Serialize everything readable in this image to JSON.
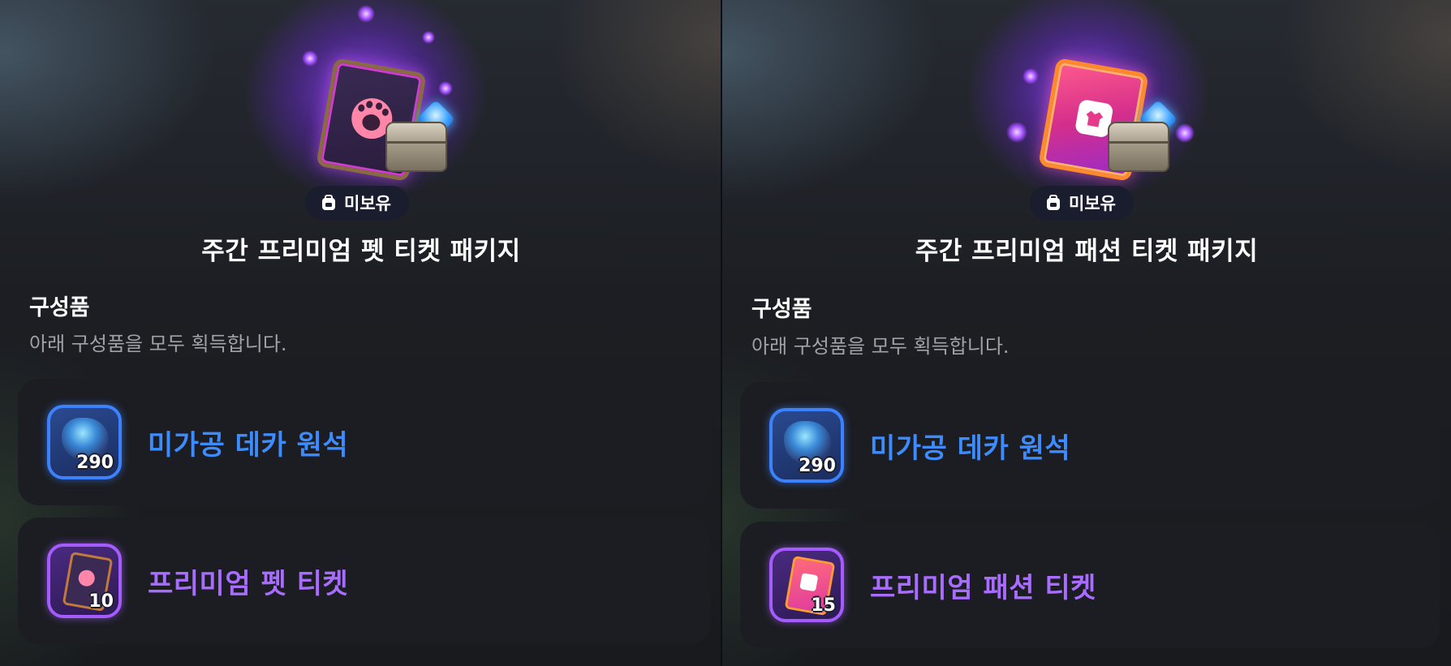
{
  "panels": [
    {
      "badge_label": "미보유",
      "package_title": "주간 프리미엄 펫 티켓 패키지",
      "contents_title": "구성품",
      "contents_desc": "아래 구성품을 모두 획득합니다.",
      "items": [
        {
          "label": "미가공 데카 원석",
          "quantity": "290",
          "icon": "raw-deca-ore-icon",
          "color": "#3d8cff"
        },
        {
          "label": "프리미엄 펫 티켓",
          "quantity": "10",
          "icon": "premium-pet-ticket-icon",
          "color": "#a86dff"
        }
      ]
    },
    {
      "badge_label": "미보유",
      "package_title": "주간 프리미엄 패션 티켓 패키지",
      "contents_title": "구성품",
      "contents_desc": "아래 구성품을 모두 획득합니다.",
      "items": [
        {
          "label": "미가공 데카 원석",
          "quantity": "290",
          "icon": "raw-deca-ore-icon",
          "color": "#3d8cff"
        },
        {
          "label": "프리미엄 패션 티켓",
          "quantity": "15",
          "icon": "premium-fashion-ticket-icon",
          "color": "#a86dff"
        }
      ]
    }
  ],
  "colors": {
    "accent_blue": "#3d8cff",
    "accent_purple": "#a86dff",
    "glow_purple": "#8a3cff",
    "badge_bg": "#1a1d2e"
  }
}
